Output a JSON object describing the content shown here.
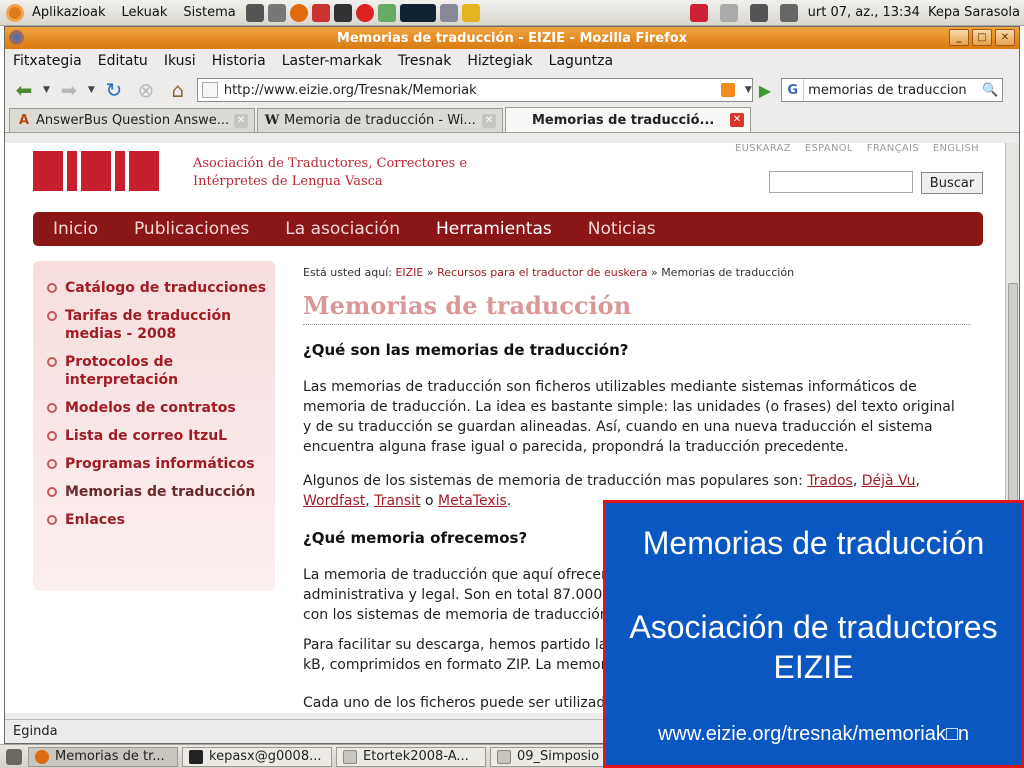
{
  "panel": {
    "menus": [
      "Aplikazioak",
      "Lekuak",
      "Sistema"
    ],
    "clock": "urt 07, az., 13:34",
    "user": "Kepa Sarasola"
  },
  "window": {
    "title": "Memorias de traducción - EIZIE - Mozilla Firefox"
  },
  "menubar": [
    "Fitxategia",
    "Editatu",
    "Ikusi",
    "Historia",
    "Laster-markak",
    "Tresnak",
    "Hiztegiak",
    "Laguntza"
  ],
  "navbar": {
    "url": "http://www.eizie.org/Tresnak/Memoriak",
    "search_query": "memorias de traduccion",
    "search_engine_icon": "G"
  },
  "tabs": [
    {
      "label": "AnswerBus Question Answe...",
      "icon": "A"
    },
    {
      "label": "Memoria de traducción - Wi...",
      "icon": "W"
    },
    {
      "label": "Memorias de traducció...",
      "icon": ""
    }
  ],
  "site": {
    "tagline_line1": "Asociación de Traductores, Correctores e",
    "tagline_line2": "Intérpretes de Lengua Vasca",
    "languages": [
      "EUSKARAZ",
      "ESPAÑOL",
      "FRANÇAIS",
      "ENGLISH"
    ],
    "search_button": "Buscar",
    "nav": [
      "Inicio",
      "Publicaciones",
      "La asociación",
      "Herramientas",
      "Noticias"
    ],
    "sidebar": [
      {
        "label": "Catálogo de traducciones"
      },
      {
        "label": "Tarifas de traducción medias - 2008"
      },
      {
        "label": "Protocolos de interpretación"
      },
      {
        "label": "Modelos de contratos"
      },
      {
        "label": "Lista de correo ItzuL"
      },
      {
        "label": "Programas informáticos"
      },
      {
        "label": "Memorias de traducción"
      },
      {
        "label": "Enlaces"
      }
    ],
    "breadcrumb": {
      "prefix": "Está usted aquí:",
      "items": [
        "EIZIE",
        "Recursos para el traductor de euskera",
        "Memorias de traducción"
      ],
      "sep": "»"
    },
    "page_title": "Memorias de traducción",
    "h2_1": "¿Qué son las memorias de traducción?",
    "p1": "Las memorias de traducción son ficheros utilizables mediante sistemas informáticos de memoria de traducción. La idea es bastante simple: las unidades (o frases) del texto original y de su traducción se guardan alineadas. Así, cuando en una nueva traducción el sistema encuentra alguna frase igual o parecida, propondrá la traducción precedente.",
    "p2_intro": "Algunos de los sistemas de memoria de traducción mas populares son:",
    "p2_links": [
      "Trados",
      "Déjà Vu",
      "Wordfast",
      "Transit",
      "MetaTexis"
    ],
    "p2_or": "o",
    "h2_2": "¿Qué memoria ofrecemos?",
    "p3_line1": "La memoria de traducción que aquí ofrecemos",
    "p3_line2": "administrativa y legal. Son en total 87.000 unida",
    "p3_line3": "con los sistemas de memoria de traducción hab",
    "p4_line1": "Para facilitar su descarga, hemos partido la me",
    "p4_line2": "kB, comprimidos en formato ZIP. La memoria c",
    "p5_line1": "Cada uno de los ficheros puede ser utilizado de"
  },
  "status": "Egindа",
  "taskbar": [
    "Memorias de tr...",
    "kepasx@g0008...",
    "Etortek2008-A...",
    "09_Simposio"
  ],
  "overlay": {
    "line1": "Memorias de traducción",
    "line2": "Asociación de traductores EIZIE",
    "line3": "www.eizie.org/tresnak/memoriak□n"
  },
  "colors": {
    "brand_red": "#c81f2f",
    "nav_dark_red": "#8a1616",
    "overlay_blue": "#0a57c2",
    "firefox_orange": "#e08a20"
  }
}
